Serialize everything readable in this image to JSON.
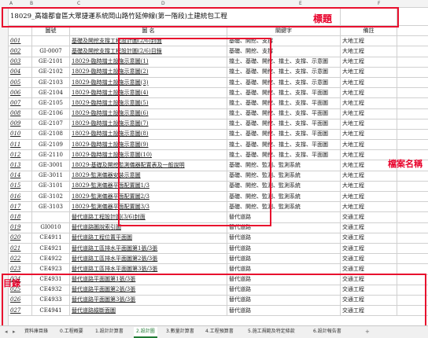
{
  "columns": [
    "A",
    "B",
    "C",
    "D",
    "E",
    "F"
  ],
  "title": "18029_高雄都會區大眾捷運系統岡山路竹延伸線(第一階段)土建統包工程",
  "header": {
    "code": "圖號",
    "name": "圖    名",
    "keyword": "關鍵字",
    "note": "備註"
  },
  "rows": [
    {
      "num": "001",
      "code": "",
      "name": "基礎及開挖支撐工程設計圖(2/6)封面",
      "kw": "基礎、開挖、支撐",
      "note": "大地工程"
    },
    {
      "num": "002",
      "code": "GI-0007",
      "name": "基礎及開挖支撐工程設計圖(2/6)目錄",
      "kw": "基礎、開挖、支撐",
      "note": "大地工程"
    },
    {
      "num": "003",
      "code": "GE-2101",
      "name": "18029-臨時擋土設施示意圖(1)",
      "kw": "擋土、基礎、開挖、擋土、支撐、示意圖",
      "note": "大地工程"
    },
    {
      "num": "004",
      "code": "GE-2102",
      "name": "18029-臨時擋土設施示意圖(2)",
      "kw": "擋土、基礎、開挖、擋土、支撐、示意圖",
      "note": "大地工程"
    },
    {
      "num": "005",
      "code": "GE-2103",
      "name": "18029-臨時擋土設施示意圖(3)",
      "kw": "擋土、基礎、開挖、擋土、支撐、示意圖",
      "note": "大地工程"
    },
    {
      "num": "006",
      "code": "GE-2104",
      "name": "18029-臨時擋土設施示意圖(4)",
      "kw": "擋土、基礎、開挖、擋土、支撐、平面圖",
      "note": "大地工程"
    },
    {
      "num": "007",
      "code": "GE-2105",
      "name": "18029-臨時擋土設施示意圖(5)",
      "kw": "擋土、基礎、開挖、擋土、支撐、平面圖",
      "note": "大地工程"
    },
    {
      "num": "008",
      "code": "GE-2106",
      "name": "18029-臨時擋土設施示意圖(6)",
      "kw": "擋土、基礎、開挖、擋土、支撐、平面圖",
      "note": "大地工程"
    },
    {
      "num": "009",
      "code": "GE-2107",
      "name": "18029-臨時擋土設施示意圖(7)",
      "kw": "擋土、基礎、開挖、擋土、支撐、平面圖",
      "note": "大地工程"
    },
    {
      "num": "010",
      "code": "GE-2108",
      "name": "18029-臨時擋土設施示意圖(8)",
      "kw": "擋土、基礎、開挖、擋土、支撐、平面圖",
      "note": "大地工程"
    },
    {
      "num": "011",
      "code": "GE-2109",
      "name": "18029-臨時擋土設施示意圖(9)",
      "kw": "擋土、基礎、開挖、擋土、支撐、平面圖",
      "note": "大地工程"
    },
    {
      "num": "012",
      "code": "GE-2110",
      "name": "18029-臨時擋土設施示意圖(10)",
      "kw": "擋土、基礎、開挖、擋土、支撐、平面圖",
      "note": "大地工程"
    },
    {
      "num": "013",
      "code": "GE-3001",
      "name": "18029-基礎及開挖監測儀器配置表及一般說明",
      "kw": "基礎、開挖、監測、監測系統",
      "note": "大地工程"
    },
    {
      "num": "014",
      "code": "GE-3011",
      "name": "18029-監測儀器安裝示意圖",
      "kw": "基礎、開挖、監測、監測系統",
      "note": "大地工程"
    },
    {
      "num": "015",
      "code": "GE-3101",
      "name": "18029-監測儀器平面配置圖1/3",
      "kw": "基礎、開挖、監測、監測系統",
      "note": "大地工程"
    },
    {
      "num": "016",
      "code": "GE-3102",
      "name": "18029-監測儀器平面配置圖2/3",
      "kw": "基礎、開挖、監測、監測系統",
      "note": "大地工程"
    },
    {
      "num": "017",
      "code": "GE-3103",
      "name": "18029-監測儀器平面配置圖3/3",
      "kw": "基礎、開挖、監測、監測系統",
      "note": "大地工程"
    },
    {
      "num": "018",
      "code": "",
      "name": "替代道路工程設計圖(3/6)封面",
      "kw": "替代道路",
      "note": "交通工程"
    },
    {
      "num": "019",
      "code": "GI0010",
      "name": "替代道路圖說索引圖",
      "kw": "替代道路",
      "note": "交通工程"
    },
    {
      "num": "020",
      "code": "CE4911",
      "name": "替代道路工程位置平面圖",
      "kw": "替代道路",
      "note": "交通工程"
    },
    {
      "num": "021",
      "code": "CE4921",
      "name": "替代道路工區排水平面圖第1張/3張",
      "kw": "替代道路",
      "note": "交通工程"
    },
    {
      "num": "022",
      "code": "CE4922",
      "name": "替代道路工區排水平面圖第2張/3張",
      "kw": "替代道路",
      "note": "交通工程"
    },
    {
      "num": "023",
      "code": "CE4923",
      "name": "替代道路工區排水平面圖第3張/3張",
      "kw": "替代道路",
      "note": "交通工程"
    },
    {
      "num": "024",
      "code": "CE4931",
      "name": "替代道路平面圖第1張/3張",
      "kw": "替代道路",
      "note": "交通工程"
    },
    {
      "num": "025",
      "code": "CE4932",
      "name": "替代道路平面圖第2張/3張",
      "kw": "替代道路",
      "note": "交通工程"
    },
    {
      "num": "026",
      "code": "CE4933",
      "name": "替代道路平面圖第3張/3張",
      "kw": "替代道路",
      "note": "交通工程"
    },
    {
      "num": "027",
      "code": "CE4941",
      "name": "替代道路縱斷面圖",
      "kw": "替代道路",
      "note": "交通工程"
    }
  ],
  "annotations": {
    "title": "標題",
    "file": "檔案名稱",
    "toc": "目錄"
  },
  "tabs": [
    "資料庫目錄",
    "0.工程概要",
    "1.設計計算書",
    "2.設計圖",
    "3.數量計算書",
    "4.工程預算書",
    "5.施工規範及特定條款",
    "6.設計報告書"
  ],
  "active_tab_index": 3,
  "nav": {
    "prev": "◂",
    "next": "▸",
    "add": "+"
  }
}
